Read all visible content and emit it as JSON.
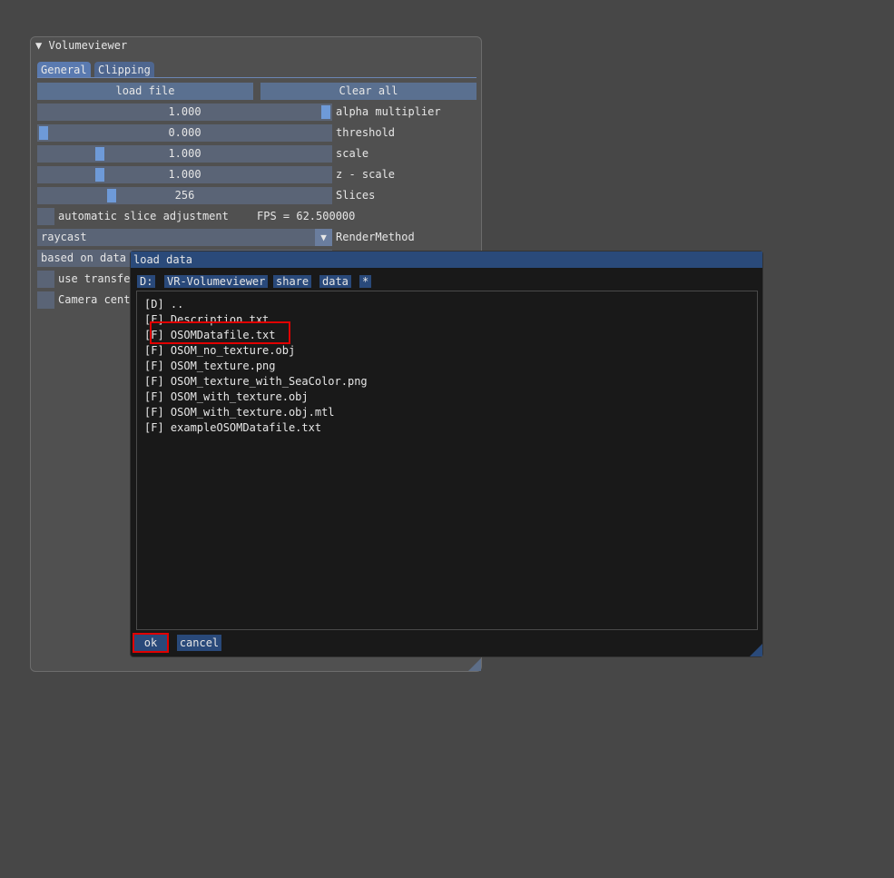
{
  "window": {
    "title": "Volumeviewer",
    "collapse_icon": "triangle-down-icon",
    "tabs": [
      {
        "label": "General"
      },
      {
        "label": "Clipping"
      }
    ],
    "buttons": {
      "load": "load file",
      "clear": "Clear all"
    },
    "sliders": [
      {
        "value": "1.000",
        "label": "alpha multiplier",
        "fraction": 1.0
      },
      {
        "value": "0.000",
        "label": "threshold",
        "fraction": 0.0
      },
      {
        "value": "1.000",
        "label": "scale",
        "fraction": 0.2
      },
      {
        "value": "1.000",
        "label": "z - scale",
        "fraction": 0.2
      },
      {
        "value": "256",
        "label": "Slices",
        "fraction": 0.24
      }
    ],
    "auto_slice": {
      "label": "automatic slice adjustment",
      "checked": false
    },
    "fps": "FPS = 62.500000",
    "render_method": {
      "value": "raycast",
      "label": "RenderMethod"
    },
    "combo2": {
      "value": "based on data"
    },
    "use_transfer": {
      "label": "use transfer fct",
      "checked": false
    },
    "camera_centric": {
      "label": "Camera centric rotations",
      "checked": false
    }
  },
  "dialog": {
    "title": "load data",
    "path": [
      "D:",
      "VR-Volumeviewer",
      "share",
      "data",
      "*"
    ],
    "files": [
      "[D] ..",
      "[F] Description.txt",
      "[F] OSOMDatafile.txt",
      "[F] OSOM_no_texture.obj",
      "[F] OSOM_texture.png",
      "[F] OSOM_texture_with_SeaColor.png",
      "[F] OSOM_with_texture.obj",
      "[F] OSOM_with_texture.obj.mtl",
      "[F] exampleOSOMDatafile.txt"
    ],
    "highlighted": "[F] OSOMDatafile.txt",
    "ok": "ok",
    "cancel": "cancel"
  },
  "colors": {
    "accent": "#2a4a7a",
    "grab": "#6e9ad8",
    "highlight": "#e00000"
  }
}
